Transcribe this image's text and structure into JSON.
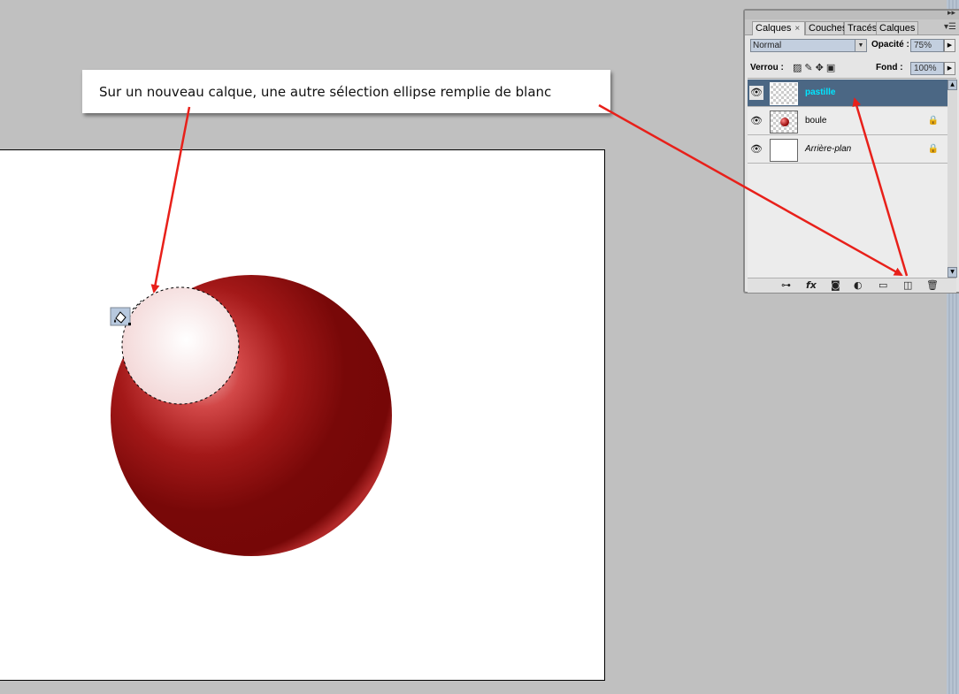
{
  "callout": {
    "text": "Sur un nouveau calque, une autre sélection ellipse remplie de blanc"
  },
  "panel": {
    "tabs": [
      {
        "label": "Calques",
        "active": true
      },
      {
        "label": "Couches",
        "active": false
      },
      {
        "label": "Tracés",
        "active": false
      },
      {
        "label": "Calques",
        "active": false
      }
    ],
    "tab_close": "×",
    "blend_mode": "Normal",
    "opacity_label": "Opacité :",
    "opacity_value": "75%",
    "lock_label": "Verrou :",
    "fill_label": "Fond :",
    "fill_value": "100%",
    "layers": [
      {
        "name": "pastille",
        "selected": true,
        "locked": false
      },
      {
        "name": "boule",
        "selected": false,
        "locked": true
      },
      {
        "name": "Arrière-plan",
        "selected": false,
        "locked": true
      }
    ]
  },
  "colors": {
    "workspace": "#c0c0c0",
    "ball": "#7a0a0a",
    "selected_layer": "#4b6784",
    "selected_layer_text": "#00e6ff",
    "arrow": "#e8201a"
  },
  "icons": [
    "eye-icon",
    "lock-icon",
    "link-icon",
    "fx-icon",
    "mask-icon",
    "adjustment-icon",
    "folder-icon",
    "new-layer-icon",
    "trash-icon",
    "paint-bucket-icon"
  ]
}
